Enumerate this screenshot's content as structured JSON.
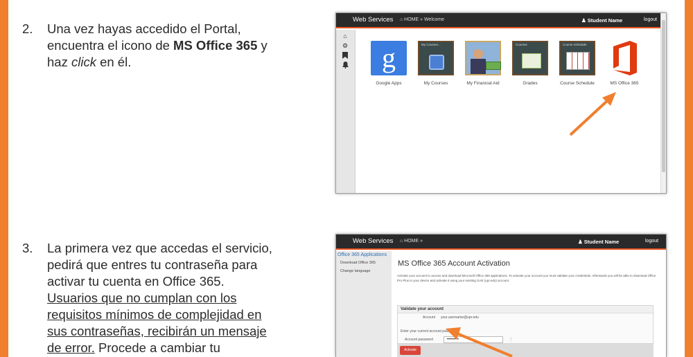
{
  "steps": [
    {
      "num": "2.",
      "text_before": "Una vez hayas accedido el Portal, encuentra el icono de ",
      "bold": "MS Office 365",
      "text_mid": " y haz ",
      "italic": "click",
      "text_after": " en él."
    },
    {
      "num": "3.",
      "text_before": "La primera vez que accedas el servicio, pedirá que entres tu contraseña para activar tu cuenta en Office 365. ",
      "underline": "Usuarios que no cumplan con los requisitos mínimos de complejidad en sus contraseñas, recibirán un mensaje de error.",
      "text_after": " Procede a cambiar tu"
    }
  ],
  "shot1": {
    "brand": "Web Services",
    "breadcrumb": "⌂ HOME » Welcome",
    "user": "♟ Student Name",
    "logout": "logout",
    "side_icons": [
      "home-icon",
      "gear-icon",
      "bookmark-icon",
      "bell-icon"
    ],
    "tiles": [
      {
        "label": "Google Apps",
        "caption": "",
        "icon": "google-g-icon"
      },
      {
        "label": "My Courses",
        "caption": "My Courses...",
        "icon": "courses-icon"
      },
      {
        "label": "My Financial Aid",
        "caption": "",
        "icon": "financial-aid-icon"
      },
      {
        "label": "Grades",
        "caption": "Courses",
        "icon": "grades-icon"
      },
      {
        "label": "Course Schedule",
        "caption": "Course Schedule",
        "icon": "schedule-icon"
      },
      {
        "label": "MS Office 365",
        "caption": "",
        "icon": "office-icon"
      }
    ]
  },
  "shot2": {
    "brand": "Web Services",
    "breadcrumb": "⌂ HOME »",
    "user": "♟ Student Name",
    "logout": "logout",
    "side_header": "Office 365 Applications",
    "side_items": [
      "Download Office 365",
      "Change language"
    ],
    "title": "MS Office 365 Account Activation",
    "description": "Activate your account to access and download Microsoft Office 365 applications. To activate your account you must validate your credentials. Afterwards you will be able to download Office Pro Plus to your device and activate it using your existing GAE (upr.edu) account.",
    "panel_title": "Validate your account",
    "account_label": "Account",
    "account_value": "your.username@upr.edu",
    "password_prompt": "Enter your current account password",
    "password_label": "Account password",
    "password_value": "••••••••",
    "activate_label": "Activate"
  },
  "colors": {
    "accent_orange": "#f07f2e",
    "topbar": "#2a2a2a",
    "office_red": "#e03a10",
    "google_blue": "#3b7de0",
    "activate_red": "#d9443a"
  }
}
